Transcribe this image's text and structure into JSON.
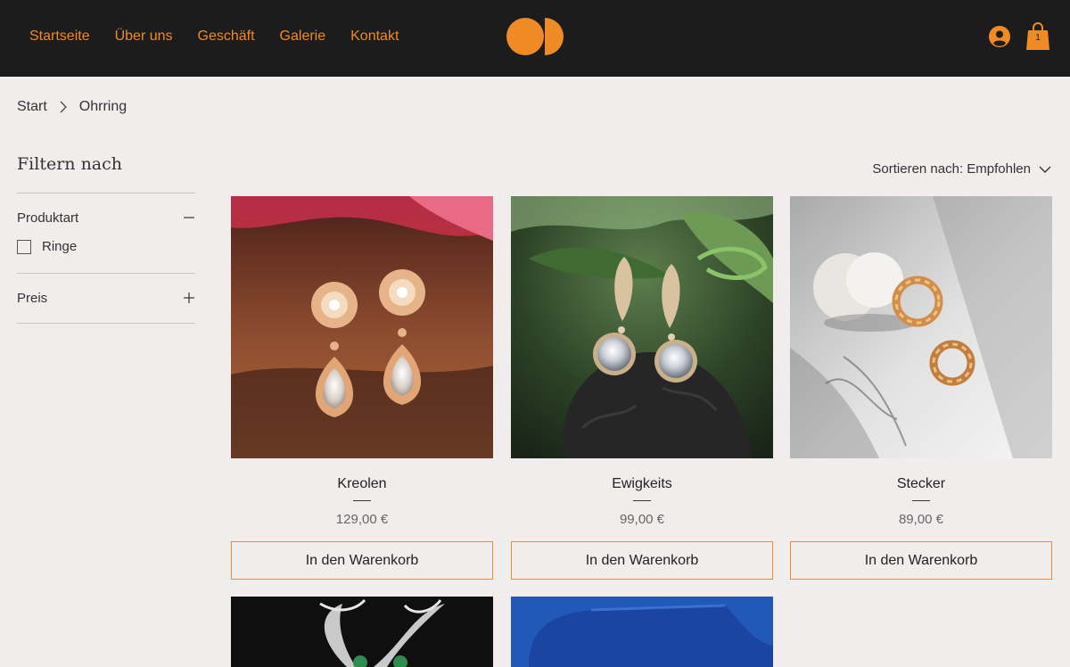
{
  "header": {
    "nav": [
      "Startseite",
      "Über uns",
      "Geschäft",
      "Galerie",
      "Kontakt"
    ],
    "cart_count": "1",
    "accent_color": "#f08a24",
    "icons": [
      "logo-icon",
      "user-icon",
      "shopping-bag-icon"
    ]
  },
  "breadcrumb": [
    "Start",
    "Ohrring"
  ],
  "filter": {
    "title": "Filtern nach",
    "facets": [
      {
        "label": "Produktart",
        "expanded": true,
        "options": [
          {
            "label": "Ringe",
            "checked": false
          }
        ]
      },
      {
        "label": "Preis",
        "expanded": false
      }
    ]
  },
  "sort": {
    "label": "Sortieren nach: Empfohlen"
  },
  "products": [
    {
      "name": "Kreolen",
      "price": "129,00 €",
      "button": "In den Warenkorb"
    },
    {
      "name": "Ewigkeits",
      "price": "99,00 €",
      "button": "In den Warenkorb"
    },
    {
      "name": "Stecker",
      "price": "89,00 €",
      "button": "In den Warenkorb"
    }
  ]
}
